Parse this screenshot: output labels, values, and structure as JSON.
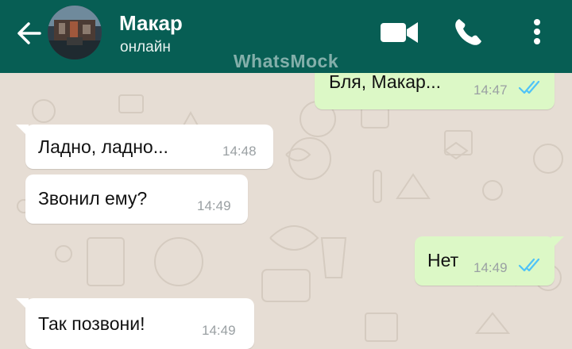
{
  "header": {
    "contact_name": "Макар",
    "contact_status": "онлайн",
    "watermark": "WhatsMock",
    "color": "#075e54"
  },
  "icons": {
    "back": "arrow-left-icon",
    "video": "video-call-icon",
    "call": "phone-icon",
    "menu": "more-vertical-icon",
    "read": "double-check-icon"
  },
  "messages": [
    {
      "direction": "out",
      "text": "Бля, Макар...",
      "time": "14:47",
      "status": "read"
    },
    {
      "direction": "in",
      "text": "Ладно, ладно...",
      "time": "14:48"
    },
    {
      "direction": "in",
      "text": "Звонил ему?",
      "time": "14:49"
    },
    {
      "direction": "out",
      "text": "Нет",
      "time": "14:49",
      "status": "read"
    },
    {
      "direction": "in",
      "text": "Так позвони!",
      "time": "14:49"
    }
  ],
  "colors": {
    "incoming": "#ffffff",
    "outgoing": "#dcf8c6",
    "wallpaper": "#e6ddd4",
    "read_tick": "#4fc3f7"
  }
}
